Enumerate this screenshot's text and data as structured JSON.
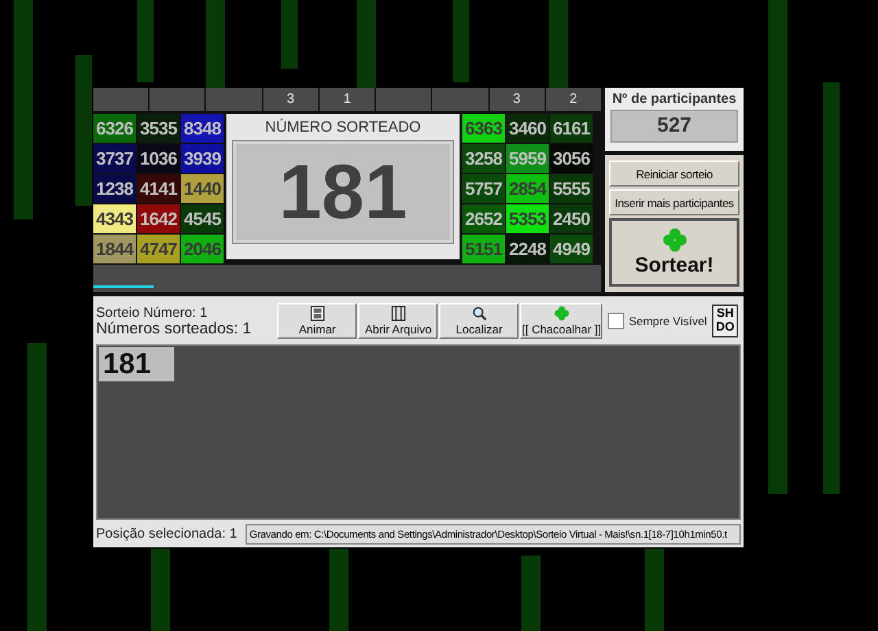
{
  "strip": [
    {
      "kind": "blank"
    },
    {
      "kind": "blank"
    },
    {
      "kind": "blank"
    },
    {
      "kind": "count",
      "value": "3"
    },
    {
      "kind": "count",
      "value": "1"
    },
    {
      "kind": "blank"
    },
    {
      "kind": "blank"
    },
    {
      "kind": "count",
      "value": "3"
    },
    {
      "kind": "count",
      "value": "2"
    }
  ],
  "left_tiles": [
    {
      "number": "6326",
      "color": "#0a6a0a"
    },
    {
      "number": "3535",
      "color": "#0a200a"
    },
    {
      "number": "8348",
      "color": "#1414b0"
    },
    {
      "number": "3737",
      "color": "#0a0a50"
    },
    {
      "number": "1036",
      "color": "#080818"
    },
    {
      "number": "3939",
      "color": "#1010a0"
    },
    {
      "number": "1238",
      "color": "#0a0a48"
    },
    {
      "number": "4141",
      "color": "#380808"
    },
    {
      "number": "1440",
      "color": "#b0a040"
    },
    {
      "number": "4343",
      "color": "#f0e880"
    },
    {
      "number": "1642",
      "color": "#900808"
    },
    {
      "number": "4545",
      "color": "#0a3a0a"
    },
    {
      "number": "1844",
      "color": "#a09860"
    },
    {
      "number": "4747",
      "color": "#a8a020"
    },
    {
      "number": "2046",
      "color": "#10b010"
    }
  ],
  "draw_panel": {
    "title": "NÚMERO SORTEADO",
    "number": "181"
  },
  "right_tiles": [
    {
      "number": "6363",
      "color": "#10d010"
    },
    {
      "number": "3460",
      "color": "#0a2a0a"
    },
    {
      "number": "6161",
      "color": "#0a3a0a"
    },
    {
      "number": "3258",
      "color": "#0a4a0a"
    },
    {
      "number": "5959",
      "color": "#10901a"
    },
    {
      "number": "3056",
      "color": "#050a05"
    },
    {
      "number": "5757",
      "color": "#0a4a0a"
    },
    {
      "number": "2854",
      "color": "#10c010"
    },
    {
      "number": "5555",
      "color": "#0a3a0a"
    },
    {
      "number": "2652",
      "color": "#0a5a0a"
    },
    {
      "number": "5353",
      "color": "#10e010"
    },
    {
      "number": "2450",
      "color": "#0a3a0a"
    },
    {
      "number": "5151",
      "color": "#10b010"
    },
    {
      "number": "2248",
      "color": "#081808"
    },
    {
      "number": "4949",
      "color": "#0a4a0a"
    }
  ],
  "progress": {
    "level": 0.12
  },
  "participants": {
    "label": "Nº de participantes",
    "value": "527"
  },
  "actions": [
    "Reiniciar sorteio",
    "Inserir mais participantes"
  ],
  "draw_button": "Sortear!",
  "info": {
    "draw_number": "Sorteio Número: 1",
    "drawn_count": "Números sorteados: 1"
  },
  "toolbar": [
    {
      "label": "Animar",
      "kind": "film"
    },
    {
      "label": "Abrir Arquivo",
      "kind": "book"
    },
    {
      "label": "Localizar",
      "kind": "search"
    },
    {
      "label": "[[ Chacoalhar ]]",
      "kind": "clover"
    }
  ],
  "always_visible": {
    "label": "Sempre Visível",
    "checked": false
  },
  "logo": [
    "SH",
    "DO"
  ],
  "drawn_numbers": [
    {
      "number": "181",
      "selected": true
    }
  ],
  "status": {
    "position": "Posição selecionada: 1",
    "path": "Gravando em: C:\\Documents and Settings\\Administrador\\Desktop\\Sorteio Virtual - Mais!\\sn.1[18-7]10h1min50.t"
  }
}
